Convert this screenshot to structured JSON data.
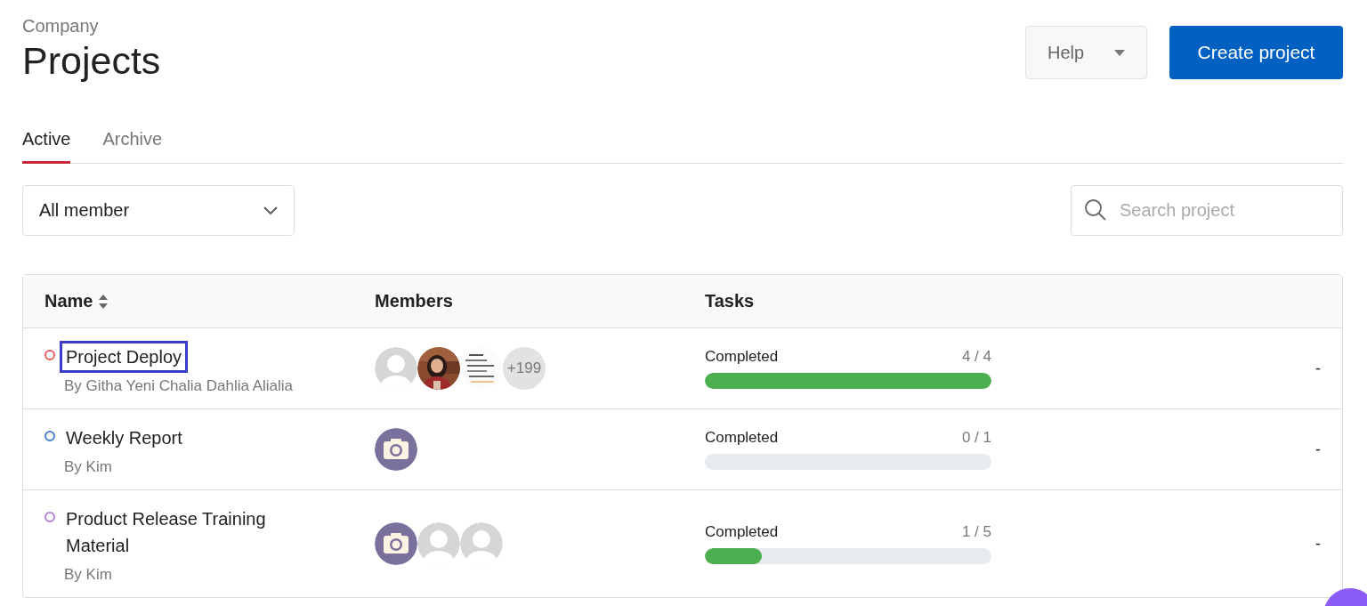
{
  "header": {
    "breadcrumb": "Company",
    "title": "Projects",
    "help_button": "Help",
    "create_button": "Create project"
  },
  "tabs": [
    {
      "label": "Active",
      "selected": true
    },
    {
      "label": "Archive",
      "selected": false
    }
  ],
  "filter": {
    "value": "All member"
  },
  "search": {
    "placeholder": "Search project"
  },
  "table": {
    "columns": [
      "Name",
      "Members",
      "Tasks"
    ],
    "rows": [
      {
        "name": "Project Deploy",
        "focused": true,
        "owner": "By Githa Yeni Chalia Dahlia Alialia",
        "color": "#e06060",
        "members": [
          {
            "kind": "default"
          },
          {
            "kind": "picture"
          },
          {
            "kind": "document"
          },
          {
            "kind": "count",
            "text": "+199"
          }
        ],
        "task_label": "Completed",
        "task_count": "4 / 4",
        "level": 1,
        "extra": "-"
      },
      {
        "name": "Weekly Report",
        "focused": false,
        "owner": "By Kim",
        "color": "#4a7fc1",
        "members": [
          {
            "kind": "camera"
          }
        ],
        "task_label": "Completed",
        "task_count": "0 / 1",
        "level": 0,
        "extra": "-"
      },
      {
        "name": "Product Release Training Material",
        "focused": false,
        "owner": "By Kim",
        "color": "#b57edc",
        "members": [
          {
            "kind": "camera"
          },
          {
            "kind": "default"
          },
          {
            "kind": "default"
          }
        ],
        "task_label": "Completed",
        "task_count": "1 / 5",
        "level": 0.2,
        "extra": "-"
      }
    ]
  }
}
